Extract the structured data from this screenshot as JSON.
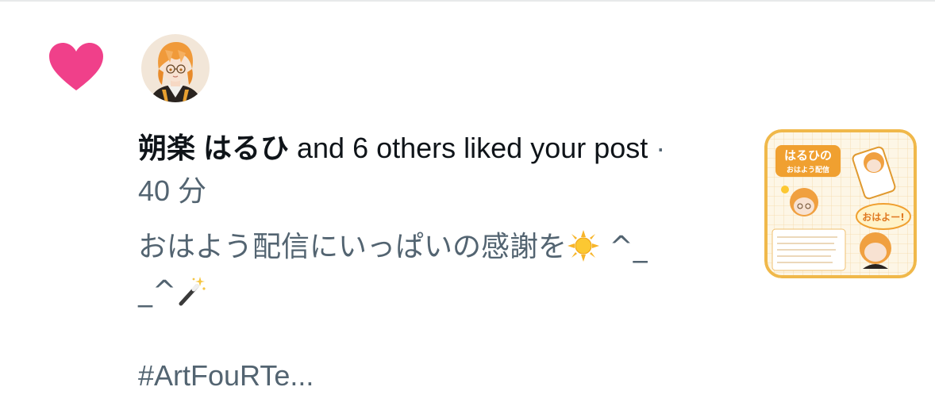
{
  "notification": {
    "type_icon": "heart-icon",
    "actor_name": "朔楽 はるひ",
    "action_text": " and 6 others liked your post",
    "separator": " · ",
    "time": "40 分",
    "post_text_line1": "おはよう配信にいっぱいの感謝を",
    "post_text_kaomoji1": "^_",
    "post_text_kaomoji2": "_^",
    "post_hashtag": "#ArtFouRTe...",
    "emojis": [
      "sun-emoji",
      "magic-wand-emoji"
    ]
  },
  "thumbnail": {
    "title": "はるひの",
    "subtitle": "おはよう配信",
    "greeting": "おはよー!"
  },
  "colors": {
    "heart": "#f0408a",
    "primary_text": "#0f1419",
    "secondary_text": "#536471",
    "divider": "#e7e9ea"
  }
}
